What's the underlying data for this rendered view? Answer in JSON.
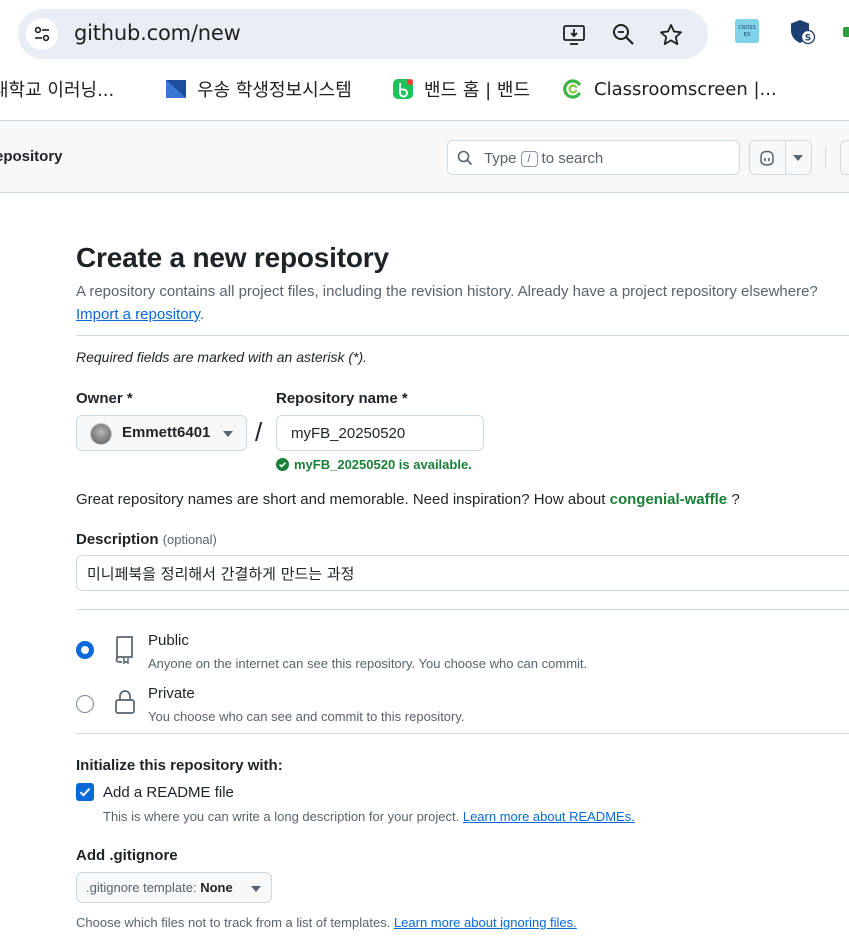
{
  "browser": {
    "url": "github.com/new",
    "extensions": [
      "cross-ex-icon",
      "shield-s-icon",
      "green-extension-icon"
    ],
    "bookmarks": [
      {
        "label": "대학교 이러닝...",
        "icon": "university-icon"
      },
      {
        "label": "우송 학생정보시스템",
        "icon": "woosong-icon"
      },
      {
        "label": "밴드 홈 | 밴드",
        "icon": "band-icon"
      },
      {
        "label": "Classroomscreen |...",
        "icon": "classroomscreen-icon"
      }
    ]
  },
  "header": {
    "context": "epository",
    "search": {
      "pre": "Type",
      "key": "/",
      "post": "to search"
    }
  },
  "form": {
    "title": "Create a new repository",
    "lead": "A repository contains all project files, including the revision history. Already have a project repository elsewhere?",
    "import_link": "Import a repository",
    "import_suffix": ".",
    "required_note": "Required fields are marked with an asterisk (*).",
    "owner_label": "Owner *",
    "owner_value": "Emmett6401",
    "slash": "/",
    "repo_label": "Repository name *",
    "repo_value": "myFB_20250520",
    "availability": "myFB_20250520 is available.",
    "inspiration_text": "Great repository names are short and memorable. Need inspiration? How about",
    "inspiration_suggestion": "congenial-waffle",
    "inspiration_suffix": " ?",
    "description_label": "Description",
    "description_optional": "(optional)",
    "description_value": "미니페북을 정리해서 간결하게 만드는 과정",
    "visibility": {
      "selected": "public",
      "public_title": "Public",
      "public_desc": "Anyone on the internet can see this repository. You choose who can commit.",
      "private_title": "Private",
      "private_desc": "You choose who can see and commit to this repository."
    },
    "init_title": "Initialize this repository with:",
    "readme_checked": true,
    "readme_label": "Add a README file",
    "readme_desc": "This is where you can write a long description for your project.",
    "readme_link": "Learn more about READMEs.",
    "gitignore_title": "Add .gitignore",
    "gitignore_label": ".gitignore template:",
    "gitignore_value": "None",
    "gitignore_desc": "Choose which files not to track from a list of templates.",
    "gitignore_link": "Learn more about ignoring files."
  },
  "colors": {
    "link": "#0969da",
    "success": "#1a7f37",
    "muted": "#59636e",
    "border": "#d1d9e0",
    "omnibox": "#e9eef6"
  }
}
